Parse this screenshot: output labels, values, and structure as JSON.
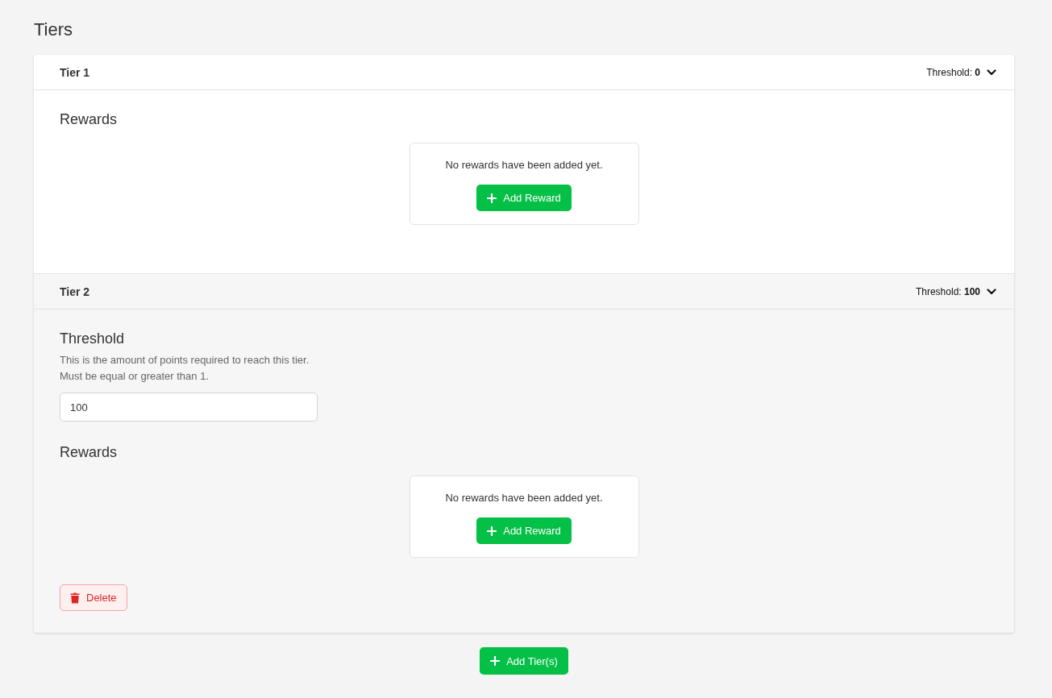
{
  "page_title": "Tiers",
  "tiers": [
    {
      "name": "Tier 1",
      "threshold_label": "Threshold:",
      "threshold_value": "0",
      "rewards": {
        "heading": "Rewards",
        "empty_text": "No rewards have been added yet.",
        "button": "Add Reward"
      }
    },
    {
      "name": "Tier 2",
      "threshold_label": "Threshold:",
      "threshold_value": "100",
      "threshold_field": {
        "label": "Threshold",
        "help": [
          "This is the amount of points required to reach this tier.",
          "Must be equal or greater than 1."
        ],
        "value": "100"
      },
      "rewards": {
        "heading": "Rewards",
        "empty_text": "No rewards have been added yet.",
        "button": "Add Reward"
      },
      "delete_button": "Delete"
    }
  ],
  "add_button": "Add Tier(s)"
}
